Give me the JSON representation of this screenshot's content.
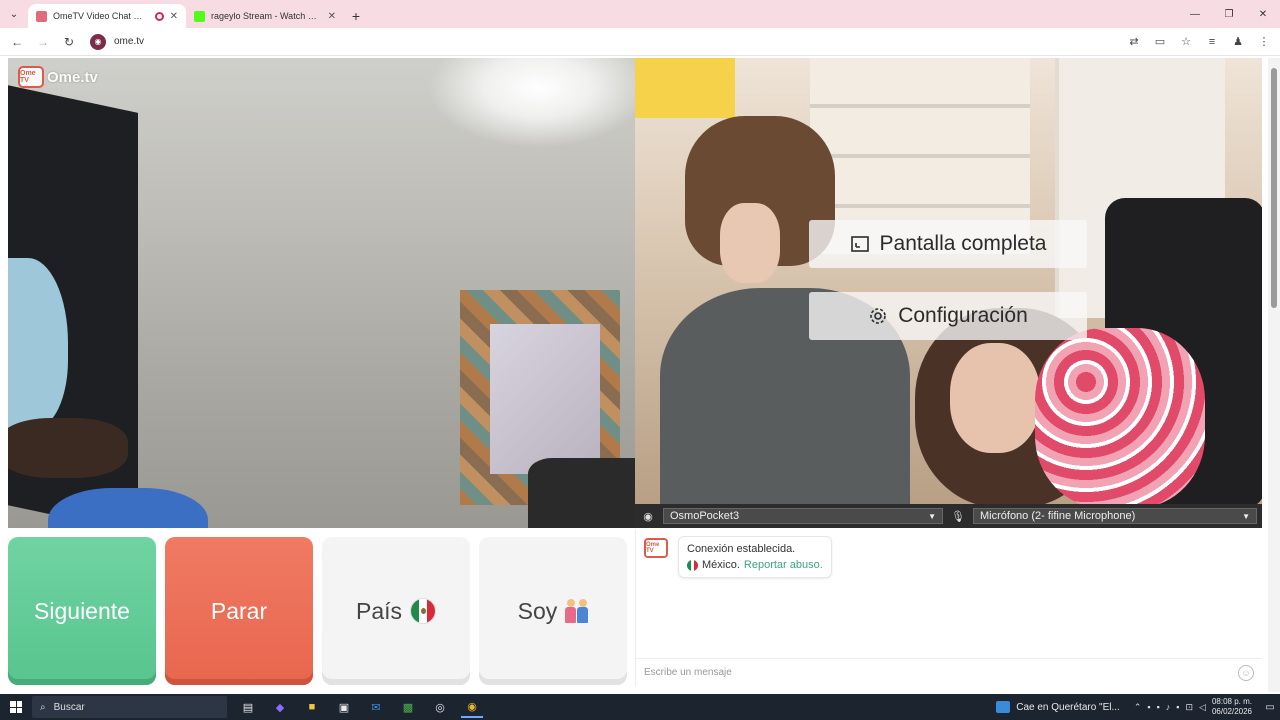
{
  "browser": {
    "tabs": [
      {
        "title": "OmeTV Video Chat — Ome",
        "active": true,
        "favicon_color": "#e06c7a",
        "recording": true
      },
      {
        "title": "rageylo Stream - Watch Live or",
        "active": false,
        "favicon_color": "#53fc18"
      }
    ],
    "address": "ome.tv",
    "nav_icons": [
      "back-icon",
      "forward-icon",
      "reload-icon"
    ],
    "address_actions": [
      "translate-icon",
      "cast-icon",
      "star-icon",
      "media-icon",
      "profile-icon",
      "menu-icon"
    ]
  },
  "site": {
    "logo_badge": "Ome TV",
    "logo_name": "Ome.tv",
    "fullscreen_label": "Pantalla completa",
    "settings_label": "Configuración",
    "camera_device": "OsmoPocket3",
    "mic_device": "Micrófono (2- fifine Microphone)"
  },
  "controls": {
    "next": "Siguiente",
    "stop": "Parar",
    "country": "País",
    "gender": "Soy"
  },
  "chat": {
    "logo_badge": "Ome TV",
    "connected": "Conexión establecida.",
    "country": "México.",
    "report": "Reportar abuso.",
    "placeholder": "Escribe un mensaje"
  },
  "colors": {
    "next": "#5fca95",
    "stop": "#ec6f57",
    "accent_link": "#3aa77a",
    "tabbar": "#f7dce4"
  },
  "taskbar": {
    "search_placeholder": "Buscar",
    "news": "Cae en Querétaro \"El...",
    "time": "08:08 p. m.",
    "date": "06/02/2026"
  }
}
